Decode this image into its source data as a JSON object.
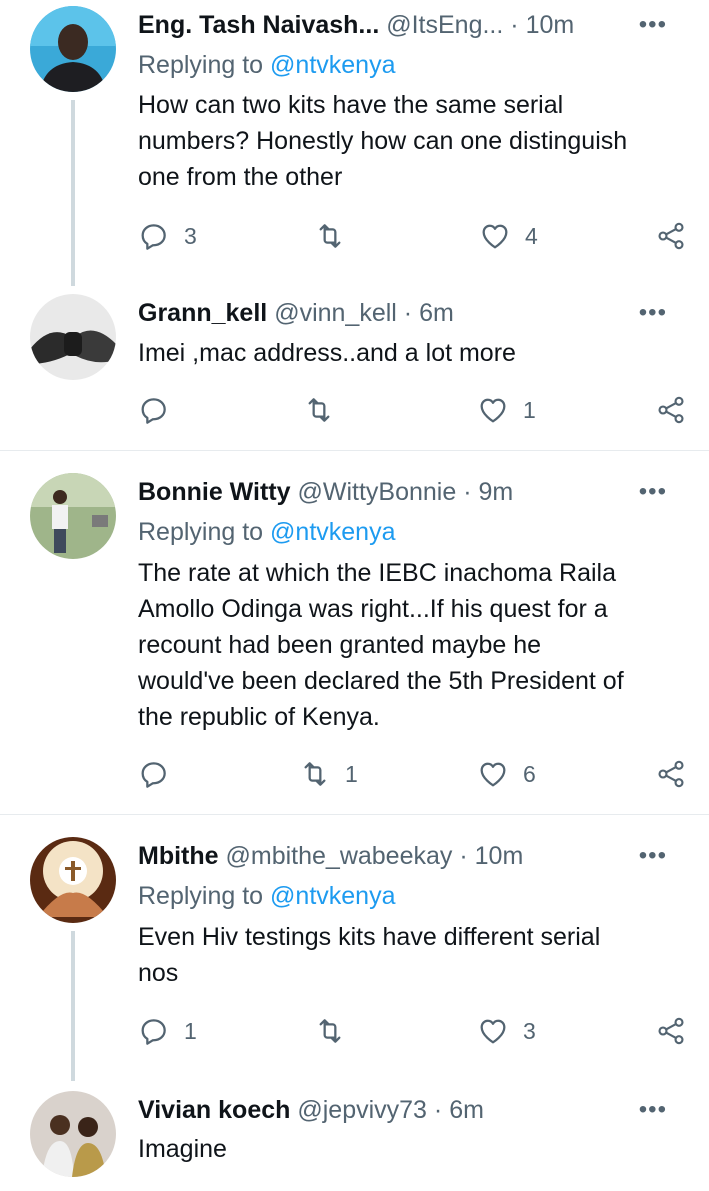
{
  "tweets": [
    {
      "name": "Eng. Tash Naivash...",
      "handle": "@ItsEng...",
      "sep": "·",
      "time": "10m",
      "more": "•••",
      "replying_prefix": "Replying to",
      "replying_to": "@ntvkenya",
      "lines": [
        "How can two kits have the same serial",
        "numbers? Honestly how can one distinguish",
        "one from the other"
      ],
      "replies": "3",
      "retweets": "",
      "likes": "4"
    },
    {
      "name": "Grann_kell",
      "handle": "@vinn_kell",
      "sep": "·",
      "time": "6m",
      "more": "•••",
      "lines": [
        "Imei ,mac address..and a lot more"
      ],
      "replies": "",
      "retweets": "",
      "likes": "1"
    },
    {
      "name": "Bonnie Witty",
      "handle": "@WittyBonnie",
      "sep": "·",
      "time": "9m",
      "more": "•••",
      "replying_prefix": "Replying to",
      "replying_to": "@ntvkenya",
      "lines": [
        "The rate at which the IEBC inachoma Raila",
        "Amollo Odinga was right...If his quest for a",
        "recount had been granted maybe he",
        "would've been declared the 5th President of",
        "the republic of Kenya."
      ],
      "replies": "",
      "retweets": "1",
      "likes": "6"
    },
    {
      "name": "Mbithe",
      "handle": "@mbithe_wabeekay",
      "sep": "·",
      "time": "10m",
      "more": "•••",
      "replying_prefix": "Replying to",
      "replying_to": "@ntvkenya",
      "lines": [
        "Even Hiv testings kits have different serial",
        "nos"
      ],
      "replies": "1",
      "retweets": "",
      "likes": "3"
    },
    {
      "name": "Vivian koech",
      "handle": "@jepvivy73",
      "sep": "·",
      "time": "6m",
      "more": "•••",
      "lines": [
        "Imagine"
      ]
    }
  ],
  "icons": {
    "reply": "reply-icon",
    "retweet": "retweet-icon",
    "like": "like-icon",
    "share": "share-icon"
  },
  "colors": {
    "text": "#0f1419",
    "secondary": "#536471",
    "link": "#1d9bf0",
    "thread_line": "#cfd9de",
    "divider": "#e7ebee"
  }
}
